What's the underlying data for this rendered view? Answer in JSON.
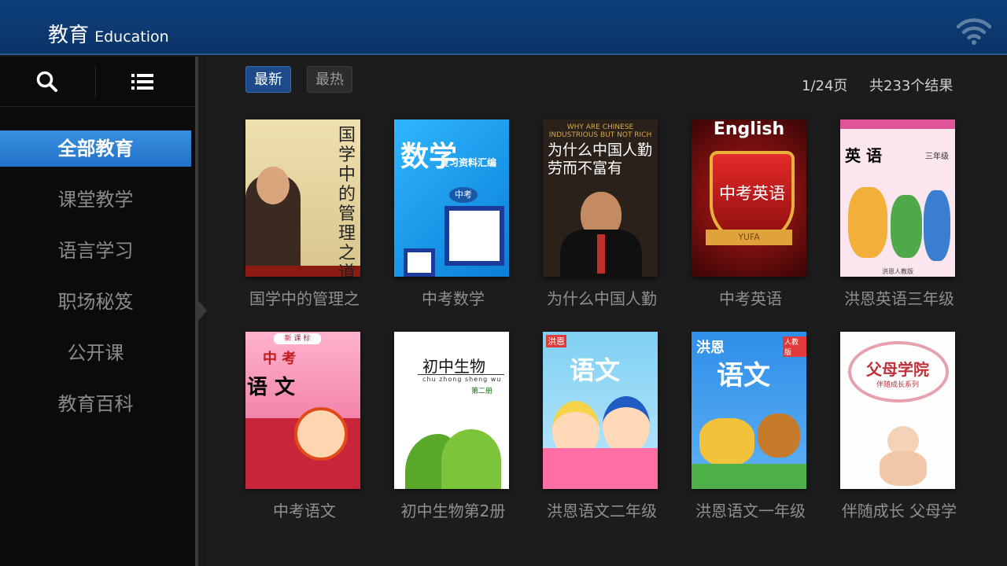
{
  "header": {
    "title_zh": "教育",
    "title_en": "Education"
  },
  "icons": {
    "wifi": "wifi-icon",
    "search": "search-icon",
    "list": "list-icon"
  },
  "sidebar": {
    "items": [
      {
        "label": "全部教育",
        "active": true
      },
      {
        "label": "课堂教学"
      },
      {
        "label": "语言学习"
      },
      {
        "label": "职场秘笈"
      },
      {
        "label": "公开课"
      },
      {
        "label": "教育百科"
      }
    ]
  },
  "filters": {
    "latest": "最新",
    "hot": "最热"
  },
  "pagination": {
    "page": "1/24页",
    "total": "共233个结果"
  },
  "books": [
    {
      "caption": "国学中的管理之",
      "cover_text": "国学中的管理之道"
    },
    {
      "caption": "中考数学",
      "cover_text": "数学",
      "cover_sub": "复习资料汇编",
      "cover_tag": "中考"
    },
    {
      "caption": "为什么中国人勤",
      "cover_text": "为什么中国人勤劳而不富有",
      "cover_en": "WHY ARE CHINESE INDUSTRIOUS BUT NOT RICH"
    },
    {
      "caption": "中考英语",
      "cover_text": "中考英语",
      "cover_en": "English",
      "cover_ribbon": "YUFA"
    },
    {
      "caption": "洪恩英语三年级",
      "cover_text": "英 语",
      "cover_tag": "三年级",
      "cover_pub": "洪恩人教版"
    },
    {
      "caption": "中考语文",
      "cover_text": "语 文",
      "cover_tag": "中 考",
      "cover_sub": "新 课 标"
    },
    {
      "caption": "初中生物第2册",
      "cover_text": "初中生物",
      "cover_sub": "chu zhong sheng wu",
      "cover_tag": "第二册"
    },
    {
      "caption": "洪恩语文二年级",
      "cover_text": "语文",
      "cover_tag": "洪恩"
    },
    {
      "caption": "洪恩语文一年级",
      "cover_text": "语文",
      "cover_tag": "洪恩",
      "cover_pub": "人教版"
    },
    {
      "caption": "伴随成长 父母学",
      "cover_text": "父母学院",
      "cover_sub": "伴随成长系列"
    }
  ],
  "colors": {
    "header_bg": "#0d3f7a",
    "active_nav": "#2a80d8",
    "sidebar_bg": "#0b0b0b",
    "main_bg": "#1c1c1c"
  }
}
